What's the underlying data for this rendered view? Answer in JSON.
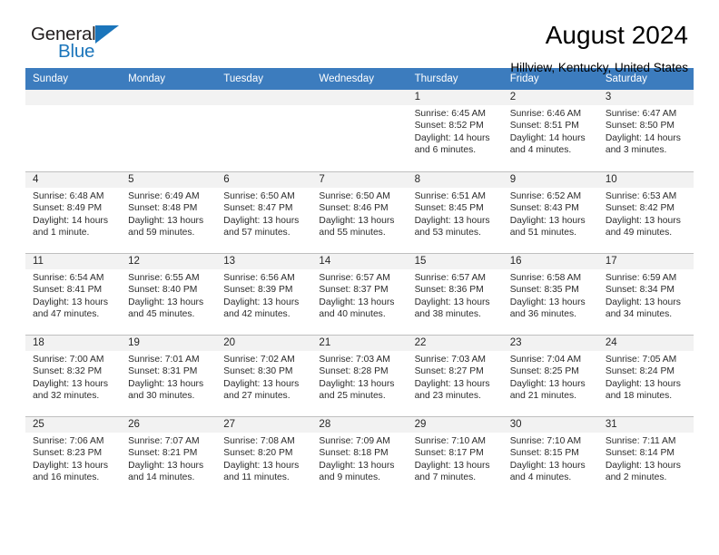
{
  "brand": {
    "name_part1": "General",
    "name_part2": "Blue",
    "triangle_color": "#1b75bb"
  },
  "header": {
    "title": "August 2024",
    "subtitle": "Hillview, Kentucky, United States"
  },
  "theme": {
    "header_row_bg": "#3c7cbe",
    "daynum_band_bg": "#f2f2f2",
    "cell_border": "#bfbfbf",
    "text": "#2b2b2b"
  },
  "weekday_headers": [
    "Sunday",
    "Monday",
    "Tuesday",
    "Wednesday",
    "Thursday",
    "Friday",
    "Saturday"
  ],
  "weeks": [
    [
      {
        "day": "",
        "l1": "",
        "l2": "",
        "l3": "",
        "l4": ""
      },
      {
        "day": "",
        "l1": "",
        "l2": "",
        "l3": "",
        "l4": ""
      },
      {
        "day": "",
        "l1": "",
        "l2": "",
        "l3": "",
        "l4": ""
      },
      {
        "day": "",
        "l1": "",
        "l2": "",
        "l3": "",
        "l4": ""
      },
      {
        "day": "1",
        "l1": "Sunrise: 6:45 AM",
        "l2": "Sunset: 8:52 PM",
        "l3": "Daylight: 14 hours",
        "l4": "and 6 minutes."
      },
      {
        "day": "2",
        "l1": "Sunrise: 6:46 AM",
        "l2": "Sunset: 8:51 PM",
        "l3": "Daylight: 14 hours",
        "l4": "and 4 minutes."
      },
      {
        "day": "3",
        "l1": "Sunrise: 6:47 AM",
        "l2": "Sunset: 8:50 PM",
        "l3": "Daylight: 14 hours",
        "l4": "and 3 minutes."
      }
    ],
    [
      {
        "day": "4",
        "l1": "Sunrise: 6:48 AM",
        "l2": "Sunset: 8:49 PM",
        "l3": "Daylight: 14 hours",
        "l4": "and 1 minute."
      },
      {
        "day": "5",
        "l1": "Sunrise: 6:49 AM",
        "l2": "Sunset: 8:48 PM",
        "l3": "Daylight: 13 hours",
        "l4": "and 59 minutes."
      },
      {
        "day": "6",
        "l1": "Sunrise: 6:50 AM",
        "l2": "Sunset: 8:47 PM",
        "l3": "Daylight: 13 hours",
        "l4": "and 57 minutes."
      },
      {
        "day": "7",
        "l1": "Sunrise: 6:50 AM",
        "l2": "Sunset: 8:46 PM",
        "l3": "Daylight: 13 hours",
        "l4": "and 55 minutes."
      },
      {
        "day": "8",
        "l1": "Sunrise: 6:51 AM",
        "l2": "Sunset: 8:45 PM",
        "l3": "Daylight: 13 hours",
        "l4": "and 53 minutes."
      },
      {
        "day": "9",
        "l1": "Sunrise: 6:52 AM",
        "l2": "Sunset: 8:43 PM",
        "l3": "Daylight: 13 hours",
        "l4": "and 51 minutes."
      },
      {
        "day": "10",
        "l1": "Sunrise: 6:53 AM",
        "l2": "Sunset: 8:42 PM",
        "l3": "Daylight: 13 hours",
        "l4": "and 49 minutes."
      }
    ],
    [
      {
        "day": "11",
        "l1": "Sunrise: 6:54 AM",
        "l2": "Sunset: 8:41 PM",
        "l3": "Daylight: 13 hours",
        "l4": "and 47 minutes."
      },
      {
        "day": "12",
        "l1": "Sunrise: 6:55 AM",
        "l2": "Sunset: 8:40 PM",
        "l3": "Daylight: 13 hours",
        "l4": "and 45 minutes."
      },
      {
        "day": "13",
        "l1": "Sunrise: 6:56 AM",
        "l2": "Sunset: 8:39 PM",
        "l3": "Daylight: 13 hours",
        "l4": "and 42 minutes."
      },
      {
        "day": "14",
        "l1": "Sunrise: 6:57 AM",
        "l2": "Sunset: 8:37 PM",
        "l3": "Daylight: 13 hours",
        "l4": "and 40 minutes."
      },
      {
        "day": "15",
        "l1": "Sunrise: 6:57 AM",
        "l2": "Sunset: 8:36 PM",
        "l3": "Daylight: 13 hours",
        "l4": "and 38 minutes."
      },
      {
        "day": "16",
        "l1": "Sunrise: 6:58 AM",
        "l2": "Sunset: 8:35 PM",
        "l3": "Daylight: 13 hours",
        "l4": "and 36 minutes."
      },
      {
        "day": "17",
        "l1": "Sunrise: 6:59 AM",
        "l2": "Sunset: 8:34 PM",
        "l3": "Daylight: 13 hours",
        "l4": "and 34 minutes."
      }
    ],
    [
      {
        "day": "18",
        "l1": "Sunrise: 7:00 AM",
        "l2": "Sunset: 8:32 PM",
        "l3": "Daylight: 13 hours",
        "l4": "and 32 minutes."
      },
      {
        "day": "19",
        "l1": "Sunrise: 7:01 AM",
        "l2": "Sunset: 8:31 PM",
        "l3": "Daylight: 13 hours",
        "l4": "and 30 minutes."
      },
      {
        "day": "20",
        "l1": "Sunrise: 7:02 AM",
        "l2": "Sunset: 8:30 PM",
        "l3": "Daylight: 13 hours",
        "l4": "and 27 minutes."
      },
      {
        "day": "21",
        "l1": "Sunrise: 7:03 AM",
        "l2": "Sunset: 8:28 PM",
        "l3": "Daylight: 13 hours",
        "l4": "and 25 minutes."
      },
      {
        "day": "22",
        "l1": "Sunrise: 7:03 AM",
        "l2": "Sunset: 8:27 PM",
        "l3": "Daylight: 13 hours",
        "l4": "and 23 minutes."
      },
      {
        "day": "23",
        "l1": "Sunrise: 7:04 AM",
        "l2": "Sunset: 8:25 PM",
        "l3": "Daylight: 13 hours",
        "l4": "and 21 minutes."
      },
      {
        "day": "24",
        "l1": "Sunrise: 7:05 AM",
        "l2": "Sunset: 8:24 PM",
        "l3": "Daylight: 13 hours",
        "l4": "and 18 minutes."
      }
    ],
    [
      {
        "day": "25",
        "l1": "Sunrise: 7:06 AM",
        "l2": "Sunset: 8:23 PM",
        "l3": "Daylight: 13 hours",
        "l4": "and 16 minutes."
      },
      {
        "day": "26",
        "l1": "Sunrise: 7:07 AM",
        "l2": "Sunset: 8:21 PM",
        "l3": "Daylight: 13 hours",
        "l4": "and 14 minutes."
      },
      {
        "day": "27",
        "l1": "Sunrise: 7:08 AM",
        "l2": "Sunset: 8:20 PM",
        "l3": "Daylight: 13 hours",
        "l4": "and 11 minutes."
      },
      {
        "day": "28",
        "l1": "Sunrise: 7:09 AM",
        "l2": "Sunset: 8:18 PM",
        "l3": "Daylight: 13 hours",
        "l4": "and 9 minutes."
      },
      {
        "day": "29",
        "l1": "Sunrise: 7:10 AM",
        "l2": "Sunset: 8:17 PM",
        "l3": "Daylight: 13 hours",
        "l4": "and 7 minutes."
      },
      {
        "day": "30",
        "l1": "Sunrise: 7:10 AM",
        "l2": "Sunset: 8:15 PM",
        "l3": "Daylight: 13 hours",
        "l4": "and 4 minutes."
      },
      {
        "day": "31",
        "l1": "Sunrise: 7:11 AM",
        "l2": "Sunset: 8:14 PM",
        "l3": "Daylight: 13 hours",
        "l4": "and 2 minutes."
      }
    ]
  ]
}
